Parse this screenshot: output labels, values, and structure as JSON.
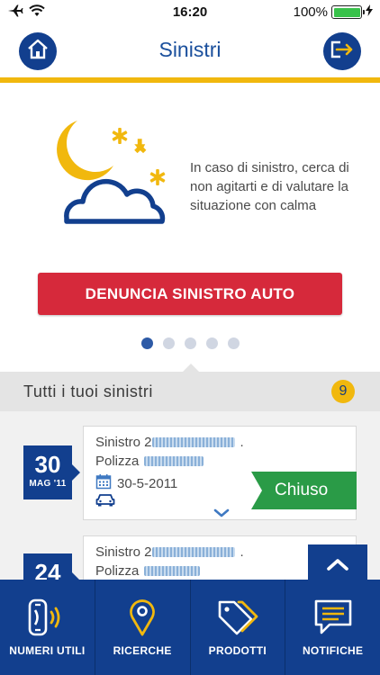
{
  "status_bar": {
    "time": "16:20",
    "battery": "100%"
  },
  "header": {
    "title": "Sinistri",
    "home_icon": "home-icon",
    "logout_icon": "logout-icon"
  },
  "hero": {
    "illustration": "moon-cloud-illustration",
    "message": "In caso di sinistro, cerca di non agitarti e di valutare la situazione con calma",
    "cta_label": "DENUNCIA SINISTRO AUTO",
    "pager_total": 5,
    "pager_active": 1
  },
  "list": {
    "title": "Tutti i tuoi sinistri",
    "count": "9",
    "items": [
      {
        "day": "30",
        "month_year": "MAG '11",
        "claim_label": "Sinistro 2",
        "policy_label": "Polizza",
        "date": "30-5-2011",
        "status": "Chiuso"
      },
      {
        "day": "24",
        "month_year": "",
        "claim_label": "Sinistro 2",
        "policy_label": "Polizza"
      }
    ]
  },
  "tabbar": {
    "items": [
      {
        "label": "NUMERI UTILI",
        "icon": "phone-icon"
      },
      {
        "label": "RICERCHE",
        "icon": "map-pin-icon"
      },
      {
        "label": "PRODOTTI",
        "icon": "tags-icon"
      },
      {
        "label": "NOTIFICHE",
        "icon": "message-icon"
      }
    ]
  },
  "colors": {
    "brand_blue": "#123f8e",
    "accent_yellow": "#f1b80e",
    "cta_red": "#d6293b",
    "status_green": "#2a9b47"
  }
}
